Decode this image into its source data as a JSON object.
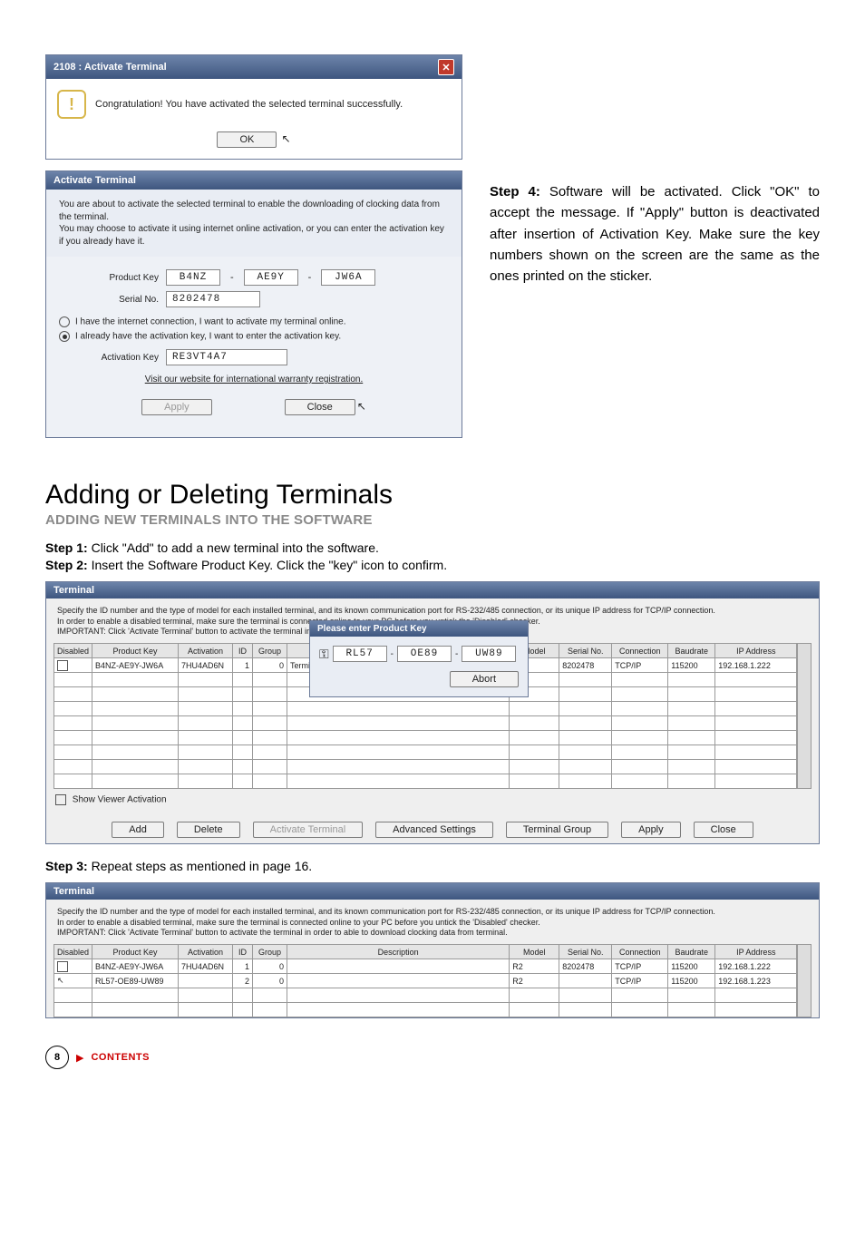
{
  "dialog_success": {
    "title": "2108 : Activate Terminal",
    "message": "Congratulation! You have activated the selected terminal successfully.",
    "ok": "OK"
  },
  "activate_panel": {
    "title": "Activate Terminal",
    "intro": "You are about to activate the selected terminal to enable the downloading of clocking data from the terminal.\nYou may choose to activate it using internet online activation, or you can enter the activation key if you already have it.",
    "product_key_label": "Product Key",
    "product_key": {
      "a": "B4NZ",
      "b": "AE9Y",
      "c": "JW6A"
    },
    "serial_label": "Serial No.",
    "serial": "8202478",
    "radio_online": "I have the internet connection, I want to activate my terminal online.",
    "radio_key": "I already have the activation key, I want to enter the activation key.",
    "activation_key_label": "Activation Key",
    "activation_key": "RE3VT4A7",
    "warranty_link": "Visit our website for international warranty registration.",
    "apply": "Apply",
    "close": "Close"
  },
  "step4": {
    "heading": "Step 4:",
    "body": " Software will be activated. Click \"OK\" to accept the message. If \"Apply\" button is deactivated after insertion of Activation Key. Make sure the key numbers shown on the screen are the same as the ones printed on the sticker."
  },
  "section": {
    "h1": "Adding or Deleting Terminals",
    "h2": "ADDING NEW TERMINALS INTO THE SOFTWARE",
    "step1_b": "Step 1:",
    "step1": " Click \"Add\" to add a new terminal into the software.",
    "step2_b": "Step 2:",
    "step2": " Insert the Software Product Key. Click the \"key\" icon to confirm.",
    "step3_b": "Step 3:",
    "step3": " Repeat steps as mentioned in page 16."
  },
  "terminal_panel": {
    "title": "Terminal",
    "desc": "Specify the ID number and the type of model for each installed terminal, and its known communication port for RS-232/485 connection, or its unique IP address for TCP/IP connection.\nIn order to enable a disabled terminal, make sure the terminal is connected online to your PC before you untick the 'Disabled' checker.\nIMPORTANT: Click 'Activate Terminal' button to activate the terminal in order to able to download clocking data from terminal.",
    "cols": [
      "Disabled",
      "Product Key",
      "Activation",
      "ID",
      "Group",
      "Description",
      "Model",
      "Serial No.",
      "Connection",
      "Baudrate",
      "IP Address"
    ],
    "row1": {
      "pk": "B4NZ-AE9Y-JW6A",
      "act": "7HU4AD6N",
      "id": "1",
      "grp": "0",
      "desc": "Terminal 1",
      "model": "R2",
      "sn": "8202478",
      "conn": "TCP/IP",
      "baud": "115200",
      "ip": "192.168.1.222"
    },
    "row2": {
      "pk": "RL57-OE89-UW89",
      "act": "",
      "id": "2",
      "grp": "0",
      "desc": "",
      "model": "R2",
      "sn": "",
      "conn": "TCP/IP",
      "baud": "115200",
      "ip": "192.168.1.223"
    },
    "show_viewer": "Show Viewer Activation",
    "btns": {
      "add": "Add",
      "delete": "Delete",
      "activate": "Activate Terminal",
      "advanced": "Advanced Settings",
      "group": "Terminal Group",
      "apply": "Apply",
      "close": "Close"
    }
  },
  "pk_popup": {
    "title": "Please enter Product Key",
    "a": "RL57",
    "b": "OE89",
    "c": "UW89",
    "abort": "Abort"
  },
  "footer": {
    "page": "8",
    "contents": "CONTENTS"
  }
}
